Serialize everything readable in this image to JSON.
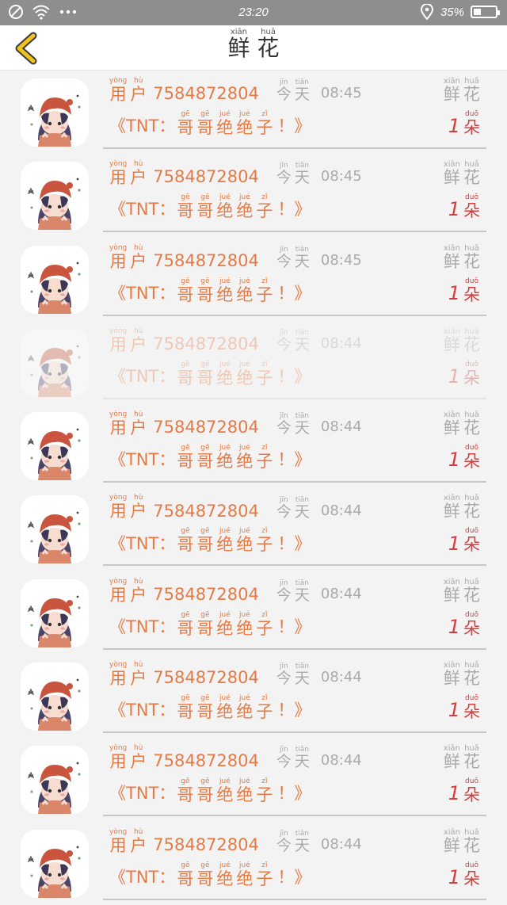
{
  "status_bar": {
    "time": "23:20",
    "battery": "35%",
    "battery_level": 0.35,
    "icons": [
      "no-sim-icon",
      "wifi-icon",
      "more-dots-icon",
      "location-icon",
      "battery-icon"
    ]
  },
  "header": {
    "back_icon": "chevron-left-icon",
    "title": [
      {
        "py": "xiān",
        "hz": "鲜"
      },
      {
        "py": "huā",
        "hz": "花"
      }
    ]
  },
  "labels": {
    "user": [
      {
        "py": "yòng",
        "hz": "用"
      },
      {
        "py": "hù",
        "hz": "户"
      }
    ],
    "today": [
      {
        "py": "jīn",
        "hz": "今"
      },
      {
        "py": "tiān",
        "hz": "天"
      }
    ],
    "flower": [
      {
        "py": "xiān",
        "hz": "鲜"
      },
      {
        "py": "huā",
        "hz": "花"
      }
    ],
    "message_open": "《TNT：",
    "message_chars": [
      {
        "py": "gē",
        "hz": "哥"
      },
      {
        "py": "gē",
        "hz": "哥"
      },
      {
        "py": "jué",
        "hz": "绝"
      },
      {
        "py": "jué",
        "hz": "绝"
      },
      {
        "py": "zǐ",
        "hz": "子"
      }
    ],
    "message_close": "！》",
    "unit": {
      "py": "duǒ",
      "hz": "朵"
    }
  },
  "records": [
    {
      "user_id": "7584872804",
      "time": "08:45",
      "count": "1",
      "faded": false
    },
    {
      "user_id": "7584872804",
      "time": "08:45",
      "count": "1",
      "faded": false
    },
    {
      "user_id": "7584872804",
      "time": "08:45",
      "count": "1",
      "faded": false
    },
    {
      "user_id": "7584872804",
      "time": "08:44",
      "count": "1",
      "faded": true
    },
    {
      "user_id": "7584872804",
      "time": "08:44",
      "count": "1",
      "faded": false
    },
    {
      "user_id": "7584872804",
      "time": "08:44",
      "count": "1",
      "faded": false
    },
    {
      "user_id": "7584872804",
      "time": "08:44",
      "count": "1",
      "faded": false
    },
    {
      "user_id": "7584872804",
      "time": "08:44",
      "count": "1",
      "faded": false
    },
    {
      "user_id": "7584872804",
      "time": "08:44",
      "count": "1",
      "faded": false
    },
    {
      "user_id": "7584872804",
      "time": "08:44",
      "count": "1",
      "faded": false
    }
  ],
  "colors": {
    "accent": "#e67a45",
    "count": "#d73c3c",
    "muted": "#aaaaaa",
    "back_icon": "#e8b400"
  }
}
